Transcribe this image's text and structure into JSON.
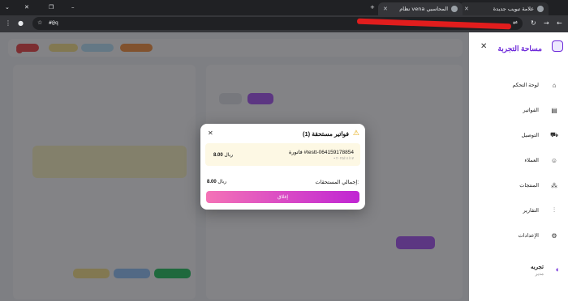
{
  "browser": {
    "tabs": [
      {
        "title": "علامة تبويب جديدة"
      },
      {
        "title": "نظام vena المحاسبي"
      }
    ],
    "new_tab": "+",
    "address": "#@q"
  },
  "sidebar": {
    "title": "مساحة التجربة",
    "close": "✕",
    "items": [
      {
        "label": "لوحة التحكم",
        "icon": "home-icon"
      },
      {
        "label": "الفواتير",
        "icon": "invoice-icon"
      },
      {
        "label": "التوصيل",
        "icon": "truck-icon"
      },
      {
        "label": "العملاء",
        "icon": "users-icon"
      },
      {
        "label": "المنتجات",
        "icon": "boxes-icon"
      },
      {
        "label": "التقارير",
        "icon": "bar-chart-icon"
      },
      {
        "label": "الإعدادات",
        "icon": "gear-icon"
      }
    ],
    "user": {
      "name": "تجربه",
      "role": "مدير"
    }
  },
  "modal": {
    "title": "فواتير مستحقة (1)",
    "invoice_label": "فاتورة #testt-064159178854",
    "invoice_sub": "• ٢٠٢٥/١١/١٧",
    "invoice_amount": "8.00",
    "currency": "ريال",
    "total_label": "إجمالي المستحقات:",
    "total_amount": "8.00",
    "close_button": "إغلاق",
    "colors": {
      "warning": "#e2a400",
      "button_start": "#f472b6",
      "button_end": "#c026d3"
    }
  }
}
